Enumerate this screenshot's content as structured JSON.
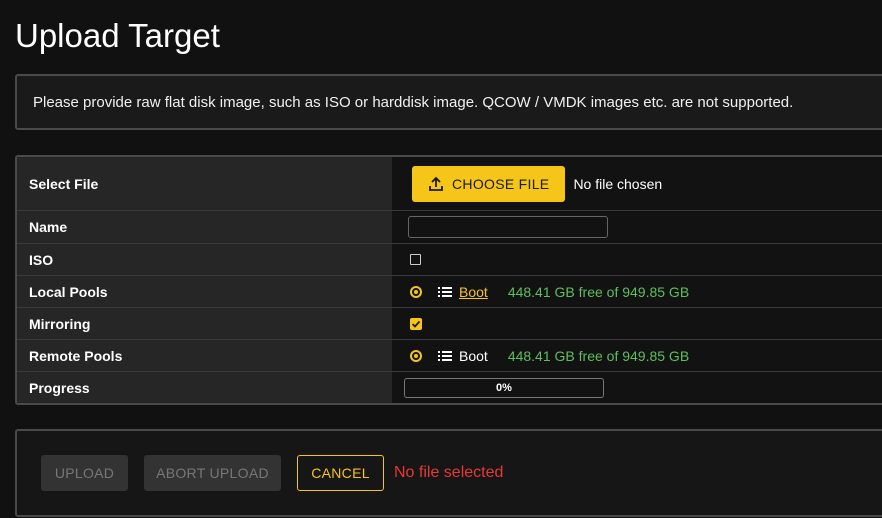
{
  "page": {
    "title": "Upload Target"
  },
  "notice": {
    "text": "Please provide raw flat disk image, such as ISO or harddisk image. QCOW / VMDK images etc. are not supported."
  },
  "form": {
    "select_file": {
      "label": "Select File",
      "button_label": "CHOOSE FILE",
      "status": "No file chosen",
      "icon": "upload-icon"
    },
    "name": {
      "label": "Name",
      "value": "",
      "placeholder": ""
    },
    "iso": {
      "label": "ISO",
      "checked": false
    },
    "local_pools": {
      "label": "Local Pools",
      "pool_name": "Boot",
      "free_text": "448.41 GB free of 949.85 GB",
      "selected": true
    },
    "mirroring": {
      "label": "Mirroring",
      "checked": true
    },
    "remote_pools": {
      "label": "Remote Pools",
      "pool_name": "Boot",
      "free_text": "448.41 GB free of 949.85 GB",
      "selected": true
    },
    "progress": {
      "label": "Progress",
      "text": "0%",
      "value": 0
    }
  },
  "actions": {
    "upload_label": "UPLOAD",
    "abort_label": "ABORT UPLOAD",
    "cancel_label": "CANCEL",
    "error_text": "No file selected"
  },
  "colors": {
    "accent": "#f5c518",
    "success": "#5fbf5f",
    "error": "#e53935",
    "background": "#111111"
  }
}
